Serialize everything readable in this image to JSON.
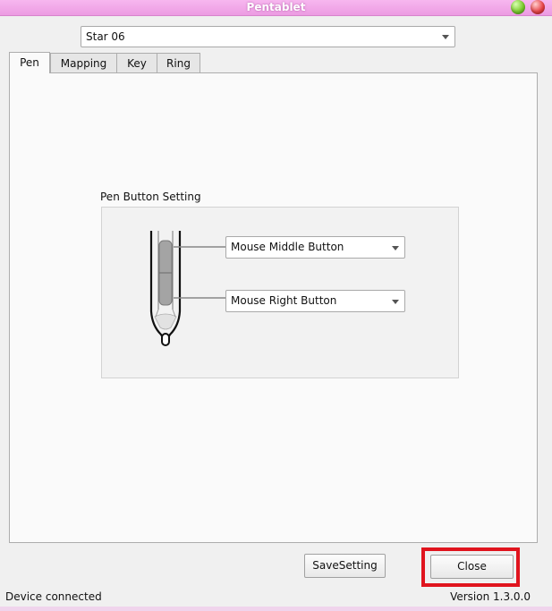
{
  "window": {
    "title": "Pentablet",
    "buttons": {
      "minimize_icon": "green-orb-icon",
      "close_icon": "red-orb-icon"
    }
  },
  "device": {
    "selected": "Star 06"
  },
  "tabs": [
    {
      "label": "Pen",
      "active": true
    },
    {
      "label": "Mapping",
      "active": false
    },
    {
      "label": "Key",
      "active": false
    },
    {
      "label": "Ring",
      "active": false
    }
  ],
  "pen_button_setting": {
    "label": "Pen Button Setting",
    "upper_button": {
      "selected": "Mouse Middle Button"
    },
    "lower_button": {
      "selected": "Mouse Right Button"
    }
  },
  "actions": {
    "save_label": "SaveSetting",
    "close_label": "Close"
  },
  "status": {
    "connection": "Device connected",
    "version": "Version 1.3.0.0"
  },
  "colors": {
    "titlebar": "#ec9be2",
    "highlight": "#e0141e",
    "panel": "#fafafa"
  }
}
